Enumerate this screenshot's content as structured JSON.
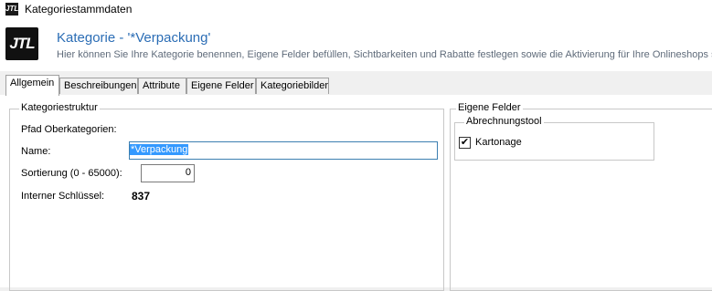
{
  "window": {
    "title": "Kategoriestammdaten",
    "app_icon": "JTL"
  },
  "header": {
    "logo": "JTL",
    "title": "Kategorie - '*Verpackung'",
    "subtitle": "Hier können Sie Ihre Kategorie benennen, Eigene Felder befüllen, Sichtbarkeiten und Rabatte festlegen sowie die Aktivierung für Ihre Onlineshops s"
  },
  "tabs": [
    "Allgemein",
    "Beschreibungen",
    "Attribute",
    "Eigene Felder",
    "Kategoriebilder"
  ],
  "active_tab": "Allgemein",
  "kategoriestruktur": {
    "group_label": "Kategoriestruktur",
    "pfad_label": "Pfad Oberkategorien:",
    "name_label": "Name:",
    "name_value": "*Verpackung",
    "sortierung_label": "Sortierung (0 - 65000):",
    "sortierung_value": "0",
    "schluessel_label": "Interner Schlüssel:",
    "schluessel_value": "837"
  },
  "eigene_felder": {
    "group_label": "Eigene Felder",
    "subgroup_label": "Abrechnungstool",
    "checkbox_label": "Kartonage",
    "checkbox_checked": true,
    "check_glyph": "✔"
  },
  "colors": {
    "accent": "#2b6db5",
    "selection": "#3399ff"
  }
}
